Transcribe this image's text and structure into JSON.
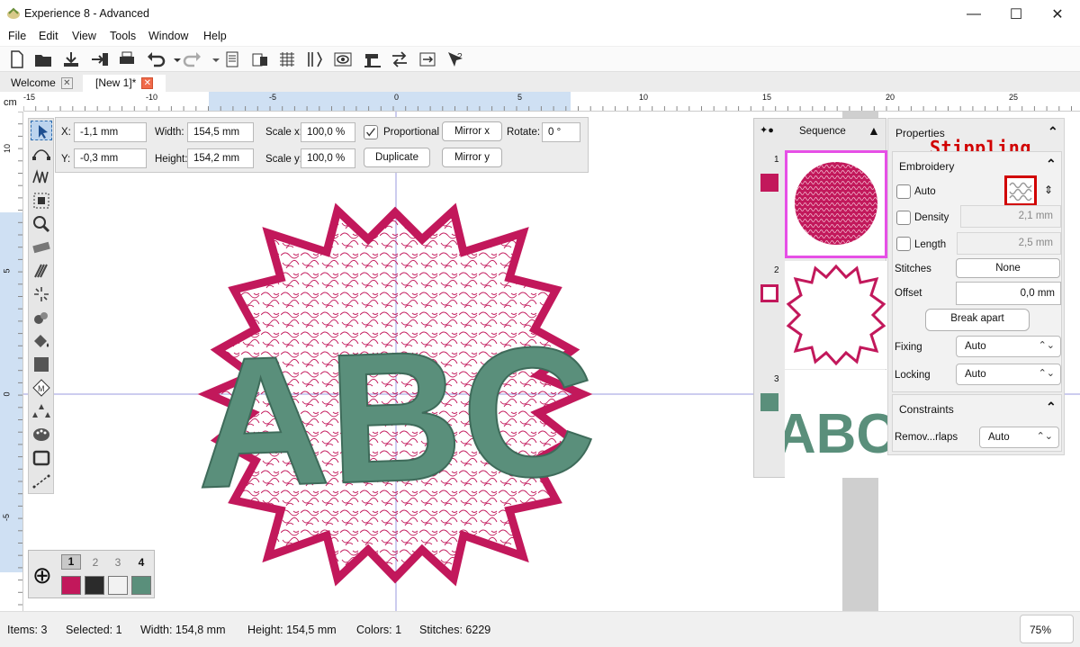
{
  "window": {
    "title": "Experience 8 - Advanced",
    "minimize": "—",
    "maximize": "☐",
    "close": "✕"
  },
  "menu": [
    "File",
    "Edit",
    "View",
    "Tools",
    "Window",
    "Help"
  ],
  "tabs": [
    {
      "label": "Welcome",
      "close": "✕"
    },
    {
      "label": "[New 1]*",
      "close": "✕"
    }
  ],
  "ruler": {
    "unit": "cm",
    "top_ticks": [
      "-15",
      "-10",
      "-5",
      "0",
      "5",
      "10",
      "15",
      "20",
      "25"
    ],
    "left_ticks": [
      "10",
      "5",
      "0",
      "-5"
    ]
  },
  "propbar": {
    "x_label": "X:",
    "x_value": "-1,1 mm",
    "y_label": "Y:",
    "y_value": "-0,3 mm",
    "width_label": "Width:",
    "width_value": "154,5 mm",
    "height_label": "Height:",
    "height_value": "154,2 mm",
    "scalex_label": "Scale x:",
    "scalex_value": "100,0 %",
    "scaley_label": "Scale y:",
    "scaley_value": "100,0 %",
    "proportional_label": "Proportional",
    "proportional_checked": true,
    "mirror_x": "Mirror x",
    "mirror_y": "Mirror y",
    "duplicate": "Duplicate",
    "rotate_label": "Rotate:",
    "rotate_value": "0 °"
  },
  "design": {
    "text": "ABC",
    "fill_color": "#c2185b",
    "text_color": "#5a8f7b"
  },
  "colors": {
    "items": [
      "1",
      "2",
      "3",
      "4"
    ],
    "add_icon": "⊕",
    "swatches": [
      "#c2185b",
      "#2b2b2b",
      "#f2f2f2",
      "#5a8f7b"
    ]
  },
  "sequence": {
    "title": "Sequence",
    "items": [
      {
        "num": "1",
        "color": "#c2185b",
        "kind": "stipple"
      },
      {
        "num": "2",
        "color": "#c2185b",
        "kind": "outline"
      },
      {
        "num": "3",
        "color": "#5a8f7b",
        "kind": "text",
        "text": "ABC"
      }
    ]
  },
  "properties": {
    "title": "Properties",
    "annotation": "Stippling",
    "embroidery": {
      "title": "Embroidery",
      "auto_label": "Auto",
      "density_label": "Density",
      "density_value": "2,1 mm",
      "length_label": "Length",
      "length_value": "2,5 mm",
      "stitches_label": "Stitches",
      "stitches_value": "None",
      "offset_label": "Offset",
      "offset_value": "0,0 mm",
      "break_apart": "Break apart",
      "fixing_label": "Fixing",
      "fixing_value": "Auto",
      "locking_label": "Locking",
      "locking_value": "Auto"
    },
    "constraints": {
      "title": "Constraints",
      "remove_label": "Remov...rlaps",
      "remove_value": "Auto"
    }
  },
  "status": {
    "items": "Items: 3",
    "selected": "Selected: 1",
    "width": "Width: 154,8 mm",
    "height": "Height: 154,5 mm",
    "colors": "Colors: 1",
    "stitches": "Stitches: 6229",
    "zoom": "75%"
  }
}
